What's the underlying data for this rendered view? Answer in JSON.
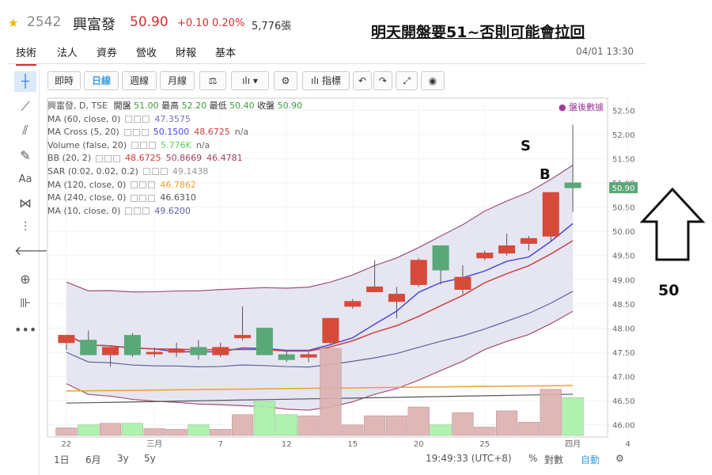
{
  "header": {
    "code": "2542",
    "name": "興富發",
    "price": "50.90",
    "change": "+0.10",
    "pct": "0.20%",
    "volume": "5,776張",
    "headline": "明天開盤要51~否則可能會拉回",
    "timestamp": "04/01 13:30"
  },
  "tabs": [
    "技術",
    "法人",
    "資券",
    "營收",
    "財報",
    "基本"
  ],
  "toolbar": {
    "buttons": [
      "即時",
      "日線",
      "週線",
      "月線"
    ],
    "indicator_label": "指標"
  },
  "legend": {
    "main": {
      "name": "興富發, D, TSE",
      "open_label": "開盤",
      "open": "51.00",
      "high_label": "最高",
      "high": "52.20",
      "low_label": "最低",
      "low": "50.40",
      "close_label": "收盤",
      "close": "50.90"
    },
    "rows": [
      {
        "name": "MA (60, close, 0)",
        "vals": [
          "47.3575"
        ],
        "colors": [
          "#7070c0"
        ]
      },
      {
        "name": "MA Cross (5, 20)",
        "vals": [
          "50.1500",
          "48.6725",
          "n/a"
        ],
        "colors": [
          "#4a4ae0",
          "#d04040",
          "#666"
        ]
      },
      {
        "name": "Volume (false, 20)",
        "vals": [
          "5.776K",
          "n/a"
        ],
        "colors": [
          "#5ad05a",
          "#666"
        ]
      },
      {
        "name": "BB (20, 2)",
        "vals": [
          "48.6725",
          "50.8669",
          "46.4781"
        ],
        "colors": [
          "#d04040",
          "#a04060",
          "#a04060"
        ]
      },
      {
        "name": "SAR (0.02, 0.02, 0.2)",
        "vals": [
          "49.1438"
        ],
        "colors": [
          "#999"
        ]
      },
      {
        "name": "MA (120, close, 0)",
        "vals": [
          "46.7862"
        ],
        "colors": [
          "#f0a030"
        ]
      },
      {
        "name": "MA (240, close, 0)",
        "vals": [
          "46.6310"
        ],
        "colors": [
          "#555"
        ]
      },
      {
        "name": "MA (10, close, 0)",
        "vals": [
          "49.6200"
        ],
        "colors": [
          "#6060a0"
        ]
      }
    ]
  },
  "after_hours": "盤後數據",
  "annotations": {
    "s": "S",
    "b": "B",
    "arrow_value": "50"
  },
  "bottom": {
    "ranges": [
      "1日",
      "6月",
      "3y",
      "5y"
    ],
    "time": "19:49:33 (UTC+8)",
    "pct": "%",
    "log": "對數",
    "auto": "自動"
  },
  "chart_data": {
    "type": "candlestick",
    "x_labels": [
      "22",
      "三月",
      "7",
      "12",
      "15",
      "20",
      "25",
      "四月",
      "4"
    ],
    "ylim": [
      45.75,
      52.75
    ],
    "y_ticks": [
      46.0,
      46.5,
      47.0,
      47.5,
      48.0,
      48.5,
      49.0,
      49.5,
      50.0,
      50.5,
      51.0,
      51.5,
      52.0,
      52.5
    ],
    "last_price_label": "50.90",
    "candles": [
      {
        "o": 47.7,
        "h": 47.85,
        "l": 47.55,
        "c": 47.85
      },
      {
        "o": 47.75,
        "h": 47.95,
        "l": 47.45,
        "c": 47.45
      },
      {
        "o": 47.45,
        "h": 47.6,
        "l": 47.2,
        "c": 47.6
      },
      {
        "o": 47.85,
        "h": 47.9,
        "l": 47.4,
        "c": 47.45
      },
      {
        "o": 47.5,
        "h": 47.6,
        "l": 47.4,
        "c": 47.5
      },
      {
        "o": 47.5,
        "h": 47.7,
        "l": 47.4,
        "c": 47.55
      },
      {
        "o": 47.6,
        "h": 47.75,
        "l": 47.35,
        "c": 47.45
      },
      {
        "o": 47.45,
        "h": 47.7,
        "l": 47.4,
        "c": 47.6
      },
      {
        "o": 47.8,
        "h": 48.45,
        "l": 47.75,
        "c": 47.85
      },
      {
        "o": 48.0,
        "h": 48.0,
        "l": 47.45,
        "c": 47.45
      },
      {
        "o": 47.45,
        "h": 47.55,
        "l": 47.3,
        "c": 47.35
      },
      {
        "o": 47.4,
        "h": 47.5,
        "l": 47.3,
        "c": 47.45
      },
      {
        "o": 47.7,
        "h": 48.2,
        "l": 47.65,
        "c": 48.2
      },
      {
        "o": 48.45,
        "h": 48.6,
        "l": 48.4,
        "c": 48.55
      },
      {
        "o": 48.75,
        "h": 49.4,
        "l": 48.75,
        "c": 48.85
      },
      {
        "o": 48.55,
        "h": 48.85,
        "l": 48.2,
        "c": 48.7
      },
      {
        "o": 48.9,
        "h": 49.45,
        "l": 48.85,
        "c": 49.4
      },
      {
        "o": 49.7,
        "h": 49.7,
        "l": 48.9,
        "c": 49.2
      },
      {
        "o": 48.8,
        "h": 49.3,
        "l": 48.7,
        "c": 49.05
      },
      {
        "o": 49.45,
        "h": 49.6,
        "l": 49.4,
        "c": 49.55
      },
      {
        "o": 49.55,
        "h": 49.95,
        "l": 49.5,
        "c": 49.7
      },
      {
        "o": 49.75,
        "h": 49.9,
        "l": 49.6,
        "c": 49.85
      },
      {
        "o": 49.9,
        "h": 50.8,
        "l": 49.8,
        "c": 50.8
      },
      {
        "o": 51.0,
        "h": 52.2,
        "l": 50.4,
        "c": 50.9
      }
    ],
    "volume": [
      0.2,
      0.28,
      0.32,
      0.32,
      0.18,
      0.16,
      0.28,
      0.16,
      0.55,
      0.9,
      0.55,
      0.52,
      2.3,
      0.28,
      0.52,
      0.52,
      0.75,
      0.28,
      0.6,
      0.22,
      0.65,
      0.35,
      1.22,
      1.0
    ]
  }
}
